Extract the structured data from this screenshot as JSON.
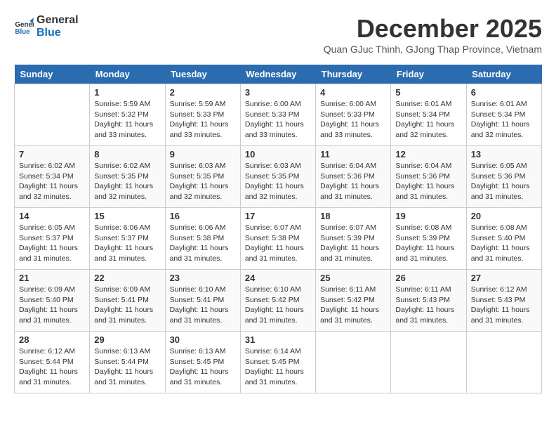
{
  "logo": {
    "line1": "General",
    "line2": "Blue"
  },
  "title": "December 2025",
  "subtitle": "Quan GJuc Thinh, GJong Thap Province, Vietnam",
  "days_of_week": [
    "Sunday",
    "Monday",
    "Tuesday",
    "Wednesday",
    "Thursday",
    "Friday",
    "Saturday"
  ],
  "weeks": [
    [
      {
        "day": "",
        "info": ""
      },
      {
        "day": "1",
        "info": "Sunrise: 5:59 AM\nSunset: 5:32 PM\nDaylight: 11 hours\nand 33 minutes."
      },
      {
        "day": "2",
        "info": "Sunrise: 5:59 AM\nSunset: 5:33 PM\nDaylight: 11 hours\nand 33 minutes."
      },
      {
        "day": "3",
        "info": "Sunrise: 6:00 AM\nSunset: 5:33 PM\nDaylight: 11 hours\nand 33 minutes."
      },
      {
        "day": "4",
        "info": "Sunrise: 6:00 AM\nSunset: 5:33 PM\nDaylight: 11 hours\nand 33 minutes."
      },
      {
        "day": "5",
        "info": "Sunrise: 6:01 AM\nSunset: 5:34 PM\nDaylight: 11 hours\nand 32 minutes."
      },
      {
        "day": "6",
        "info": "Sunrise: 6:01 AM\nSunset: 5:34 PM\nDaylight: 11 hours\nand 32 minutes."
      }
    ],
    [
      {
        "day": "7",
        "info": "Sunrise: 6:02 AM\nSunset: 5:34 PM\nDaylight: 11 hours\nand 32 minutes."
      },
      {
        "day": "8",
        "info": "Sunrise: 6:02 AM\nSunset: 5:35 PM\nDaylight: 11 hours\nand 32 minutes."
      },
      {
        "day": "9",
        "info": "Sunrise: 6:03 AM\nSunset: 5:35 PM\nDaylight: 11 hours\nand 32 minutes."
      },
      {
        "day": "10",
        "info": "Sunrise: 6:03 AM\nSunset: 5:35 PM\nDaylight: 11 hours\nand 32 minutes."
      },
      {
        "day": "11",
        "info": "Sunrise: 6:04 AM\nSunset: 5:36 PM\nDaylight: 11 hours\nand 31 minutes."
      },
      {
        "day": "12",
        "info": "Sunrise: 6:04 AM\nSunset: 5:36 PM\nDaylight: 11 hours\nand 31 minutes."
      },
      {
        "day": "13",
        "info": "Sunrise: 6:05 AM\nSunset: 5:36 PM\nDaylight: 11 hours\nand 31 minutes."
      }
    ],
    [
      {
        "day": "14",
        "info": "Sunrise: 6:05 AM\nSunset: 5:37 PM\nDaylight: 11 hours\nand 31 minutes."
      },
      {
        "day": "15",
        "info": "Sunrise: 6:06 AM\nSunset: 5:37 PM\nDaylight: 11 hours\nand 31 minutes."
      },
      {
        "day": "16",
        "info": "Sunrise: 6:06 AM\nSunset: 5:38 PM\nDaylight: 11 hours\nand 31 minutes."
      },
      {
        "day": "17",
        "info": "Sunrise: 6:07 AM\nSunset: 5:38 PM\nDaylight: 11 hours\nand 31 minutes."
      },
      {
        "day": "18",
        "info": "Sunrise: 6:07 AM\nSunset: 5:39 PM\nDaylight: 11 hours\nand 31 minutes."
      },
      {
        "day": "19",
        "info": "Sunrise: 6:08 AM\nSunset: 5:39 PM\nDaylight: 11 hours\nand 31 minutes."
      },
      {
        "day": "20",
        "info": "Sunrise: 6:08 AM\nSunset: 5:40 PM\nDaylight: 11 hours\nand 31 minutes."
      }
    ],
    [
      {
        "day": "21",
        "info": "Sunrise: 6:09 AM\nSunset: 5:40 PM\nDaylight: 11 hours\nand 31 minutes."
      },
      {
        "day": "22",
        "info": "Sunrise: 6:09 AM\nSunset: 5:41 PM\nDaylight: 11 hours\nand 31 minutes."
      },
      {
        "day": "23",
        "info": "Sunrise: 6:10 AM\nSunset: 5:41 PM\nDaylight: 11 hours\nand 31 minutes."
      },
      {
        "day": "24",
        "info": "Sunrise: 6:10 AM\nSunset: 5:42 PM\nDaylight: 11 hours\nand 31 minutes."
      },
      {
        "day": "25",
        "info": "Sunrise: 6:11 AM\nSunset: 5:42 PM\nDaylight: 11 hours\nand 31 minutes."
      },
      {
        "day": "26",
        "info": "Sunrise: 6:11 AM\nSunset: 5:43 PM\nDaylight: 11 hours\nand 31 minutes."
      },
      {
        "day": "27",
        "info": "Sunrise: 6:12 AM\nSunset: 5:43 PM\nDaylight: 11 hours\nand 31 minutes."
      }
    ],
    [
      {
        "day": "28",
        "info": "Sunrise: 6:12 AM\nSunset: 5:44 PM\nDaylight: 11 hours\nand 31 minutes."
      },
      {
        "day": "29",
        "info": "Sunrise: 6:13 AM\nSunset: 5:44 PM\nDaylight: 11 hours\nand 31 minutes."
      },
      {
        "day": "30",
        "info": "Sunrise: 6:13 AM\nSunset: 5:45 PM\nDaylight: 11 hours\nand 31 minutes."
      },
      {
        "day": "31",
        "info": "Sunrise: 6:14 AM\nSunset: 5:45 PM\nDaylight: 11 hours\nand 31 minutes."
      },
      {
        "day": "",
        "info": ""
      },
      {
        "day": "",
        "info": ""
      },
      {
        "day": "",
        "info": ""
      }
    ]
  ]
}
